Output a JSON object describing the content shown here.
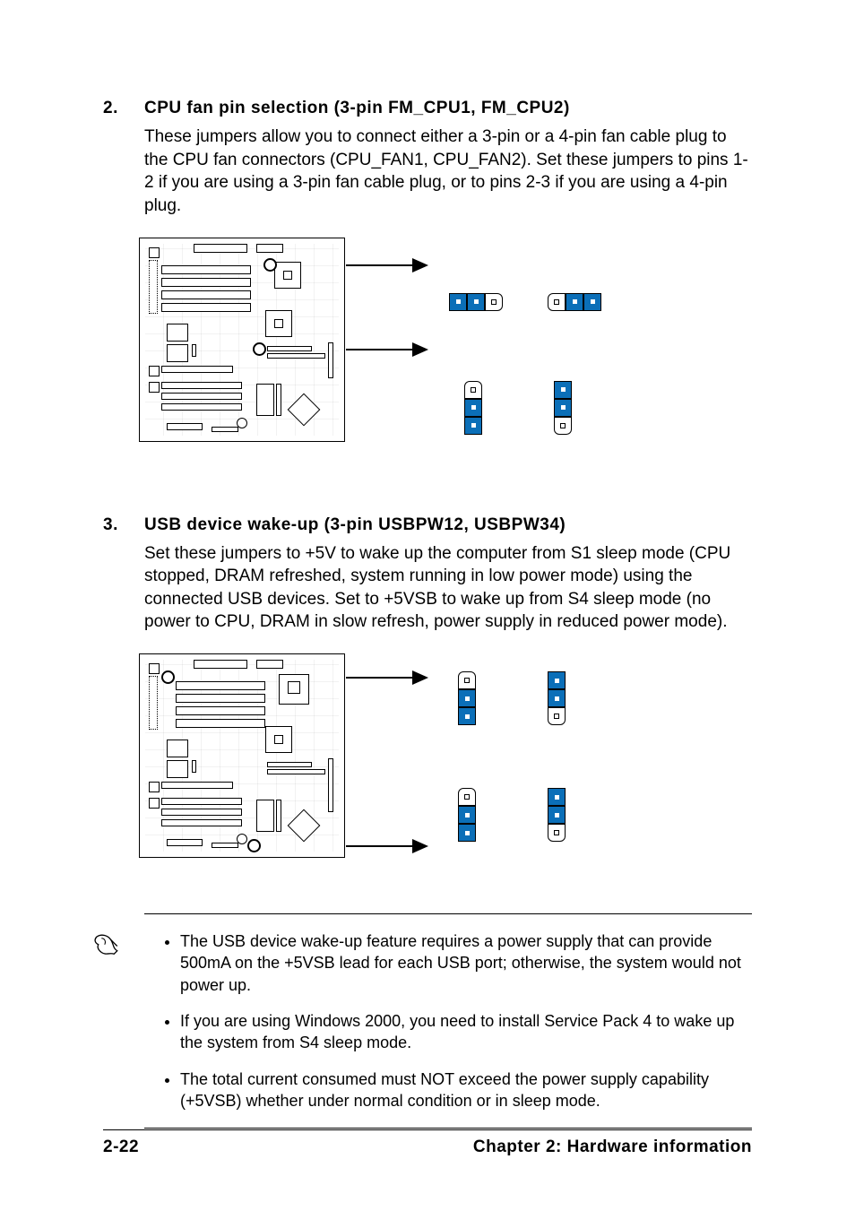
{
  "section1": {
    "number": "2.",
    "title": "CPU fan pin selection (3-pin FM_CPU1, FM_CPU2)",
    "body": "These jumpers allow you to connect either a 3-pin or a 4-pin fan cable plug to the CPU fan connectors (CPU_FAN1, CPU_FAN2). Set these jumpers to pins 1-2 if you are using a 3-pin fan cable plug, or to pins 2-3 if you are using a 4-pin plug."
  },
  "section2": {
    "number": "3.",
    "title": "USB device wake-up (3-pin USBPW12, USBPW34)",
    "body": "Set these jumpers to +5V to wake up the computer from S1 sleep mode (CPU stopped, DRAM refreshed, system running in low power mode) using the connected USB devices. Set to +5VSB to wake up from S4 sleep mode (no power to CPU, DRAM in slow refresh, power supply in reduced power mode)."
  },
  "notes": {
    "items": [
      "The USB device wake-up feature requires a power supply that can provide 500mA on the +5VSB lead for each USB port; otherwise, the system would not power up.",
      "If you are using Windows 2000, you need to install Service Pack 4 to wake up the system from S4 sleep mode.",
      "The total current consumed must NOT exceed the power supply capability (+5VSB) whether under normal condition or in sleep mode."
    ]
  },
  "footer": {
    "page": "2-22",
    "chapter": "Chapter 2: Hardware information"
  }
}
